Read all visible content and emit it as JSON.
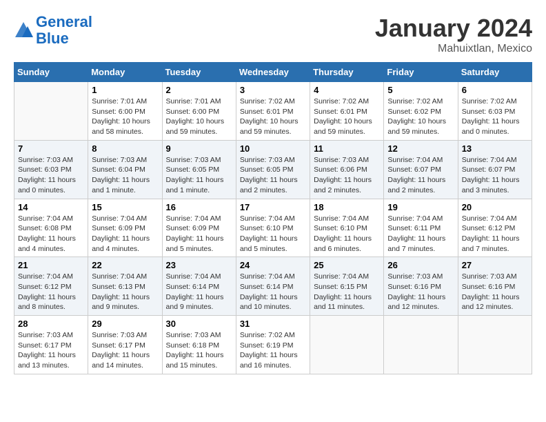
{
  "header": {
    "logo_line1": "General",
    "logo_line2": "Blue",
    "title": "January 2024",
    "location": "Mahuixtlan, Mexico"
  },
  "days_of_week": [
    "Sunday",
    "Monday",
    "Tuesday",
    "Wednesday",
    "Thursday",
    "Friday",
    "Saturday"
  ],
  "weeks": [
    [
      {
        "day": "",
        "sunrise": "",
        "sunset": "",
        "daylight": ""
      },
      {
        "day": "1",
        "sunrise": "Sunrise: 7:01 AM",
        "sunset": "Sunset: 6:00 PM",
        "daylight": "Daylight: 10 hours and 58 minutes."
      },
      {
        "day": "2",
        "sunrise": "Sunrise: 7:01 AM",
        "sunset": "Sunset: 6:00 PM",
        "daylight": "Daylight: 10 hours and 59 minutes."
      },
      {
        "day": "3",
        "sunrise": "Sunrise: 7:02 AM",
        "sunset": "Sunset: 6:01 PM",
        "daylight": "Daylight: 10 hours and 59 minutes."
      },
      {
        "day": "4",
        "sunrise": "Sunrise: 7:02 AM",
        "sunset": "Sunset: 6:01 PM",
        "daylight": "Daylight: 10 hours and 59 minutes."
      },
      {
        "day": "5",
        "sunrise": "Sunrise: 7:02 AM",
        "sunset": "Sunset: 6:02 PM",
        "daylight": "Daylight: 10 hours and 59 minutes."
      },
      {
        "day": "6",
        "sunrise": "Sunrise: 7:02 AM",
        "sunset": "Sunset: 6:03 PM",
        "daylight": "Daylight: 11 hours and 0 minutes."
      }
    ],
    [
      {
        "day": "7",
        "sunrise": "Sunrise: 7:03 AM",
        "sunset": "Sunset: 6:03 PM",
        "daylight": "Daylight: 11 hours and 0 minutes."
      },
      {
        "day": "8",
        "sunrise": "Sunrise: 7:03 AM",
        "sunset": "Sunset: 6:04 PM",
        "daylight": "Daylight: 11 hours and 1 minute."
      },
      {
        "day": "9",
        "sunrise": "Sunrise: 7:03 AM",
        "sunset": "Sunset: 6:05 PM",
        "daylight": "Daylight: 11 hours and 1 minute."
      },
      {
        "day": "10",
        "sunrise": "Sunrise: 7:03 AM",
        "sunset": "Sunset: 6:05 PM",
        "daylight": "Daylight: 11 hours and 2 minutes."
      },
      {
        "day": "11",
        "sunrise": "Sunrise: 7:03 AM",
        "sunset": "Sunset: 6:06 PM",
        "daylight": "Daylight: 11 hours and 2 minutes."
      },
      {
        "day": "12",
        "sunrise": "Sunrise: 7:04 AM",
        "sunset": "Sunset: 6:07 PM",
        "daylight": "Daylight: 11 hours and 2 minutes."
      },
      {
        "day": "13",
        "sunrise": "Sunrise: 7:04 AM",
        "sunset": "Sunset: 6:07 PM",
        "daylight": "Daylight: 11 hours and 3 minutes."
      }
    ],
    [
      {
        "day": "14",
        "sunrise": "Sunrise: 7:04 AM",
        "sunset": "Sunset: 6:08 PM",
        "daylight": "Daylight: 11 hours and 4 minutes."
      },
      {
        "day": "15",
        "sunrise": "Sunrise: 7:04 AM",
        "sunset": "Sunset: 6:09 PM",
        "daylight": "Daylight: 11 hours and 4 minutes."
      },
      {
        "day": "16",
        "sunrise": "Sunrise: 7:04 AM",
        "sunset": "Sunset: 6:09 PM",
        "daylight": "Daylight: 11 hours and 5 minutes."
      },
      {
        "day": "17",
        "sunrise": "Sunrise: 7:04 AM",
        "sunset": "Sunset: 6:10 PM",
        "daylight": "Daylight: 11 hours and 5 minutes."
      },
      {
        "day": "18",
        "sunrise": "Sunrise: 7:04 AM",
        "sunset": "Sunset: 6:10 PM",
        "daylight": "Daylight: 11 hours and 6 minutes."
      },
      {
        "day": "19",
        "sunrise": "Sunrise: 7:04 AM",
        "sunset": "Sunset: 6:11 PM",
        "daylight": "Daylight: 11 hours and 7 minutes."
      },
      {
        "day": "20",
        "sunrise": "Sunrise: 7:04 AM",
        "sunset": "Sunset: 6:12 PM",
        "daylight": "Daylight: 11 hours and 7 minutes."
      }
    ],
    [
      {
        "day": "21",
        "sunrise": "Sunrise: 7:04 AM",
        "sunset": "Sunset: 6:12 PM",
        "daylight": "Daylight: 11 hours and 8 minutes."
      },
      {
        "day": "22",
        "sunrise": "Sunrise: 7:04 AM",
        "sunset": "Sunset: 6:13 PM",
        "daylight": "Daylight: 11 hours and 9 minutes."
      },
      {
        "day": "23",
        "sunrise": "Sunrise: 7:04 AM",
        "sunset": "Sunset: 6:14 PM",
        "daylight": "Daylight: 11 hours and 9 minutes."
      },
      {
        "day": "24",
        "sunrise": "Sunrise: 7:04 AM",
        "sunset": "Sunset: 6:14 PM",
        "daylight": "Daylight: 11 hours and 10 minutes."
      },
      {
        "day": "25",
        "sunrise": "Sunrise: 7:04 AM",
        "sunset": "Sunset: 6:15 PM",
        "daylight": "Daylight: 11 hours and 11 minutes."
      },
      {
        "day": "26",
        "sunrise": "Sunrise: 7:03 AM",
        "sunset": "Sunset: 6:16 PM",
        "daylight": "Daylight: 11 hours and 12 minutes."
      },
      {
        "day": "27",
        "sunrise": "Sunrise: 7:03 AM",
        "sunset": "Sunset: 6:16 PM",
        "daylight": "Daylight: 11 hours and 12 minutes."
      }
    ],
    [
      {
        "day": "28",
        "sunrise": "Sunrise: 7:03 AM",
        "sunset": "Sunset: 6:17 PM",
        "daylight": "Daylight: 11 hours and 13 minutes."
      },
      {
        "day": "29",
        "sunrise": "Sunrise: 7:03 AM",
        "sunset": "Sunset: 6:17 PM",
        "daylight": "Daylight: 11 hours and 14 minutes."
      },
      {
        "day": "30",
        "sunrise": "Sunrise: 7:03 AM",
        "sunset": "Sunset: 6:18 PM",
        "daylight": "Daylight: 11 hours and 15 minutes."
      },
      {
        "day": "31",
        "sunrise": "Sunrise: 7:02 AM",
        "sunset": "Sunset: 6:19 PM",
        "daylight": "Daylight: 11 hours and 16 minutes."
      },
      {
        "day": "",
        "sunrise": "",
        "sunset": "",
        "daylight": ""
      },
      {
        "day": "",
        "sunrise": "",
        "sunset": "",
        "daylight": ""
      },
      {
        "day": "",
        "sunrise": "",
        "sunset": "",
        "daylight": ""
      }
    ]
  ]
}
